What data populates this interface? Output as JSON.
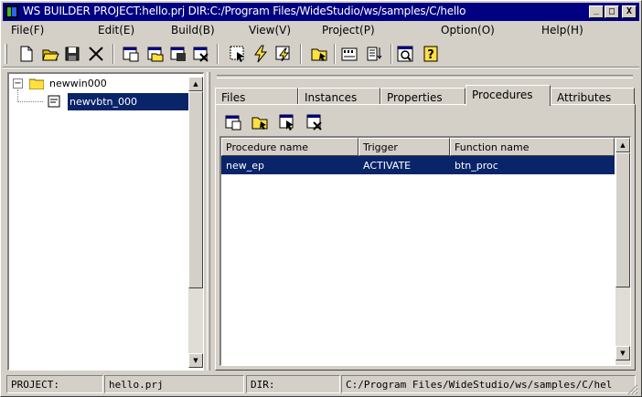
{
  "window": {
    "title": "WS BUILDER PROJECT:hello.prj DIR:C:/Program Files/WideStudio/ws/samples/C/hello",
    "minimize": "_",
    "maximize": "□",
    "close": "X"
  },
  "menu": [
    "File(F)",
    "Edit(E)",
    "Build(B)",
    "View(V)",
    "Project(P)",
    "Option(O)",
    "Help(H)"
  ],
  "toolbar": {
    "icons": [
      "new-file-icon",
      "open-folder-icon",
      "save-disk-icon",
      "cut-icon",
      "new-window-icon",
      "open-window-icon",
      "save-window-icon",
      "close-window-icon",
      "select-object-icon",
      "lightning-build-icon",
      "build-all-icon",
      "open-project-icon",
      "form-icon",
      "sort-list-icon",
      "preview-icon",
      "help-icon"
    ]
  },
  "tree": {
    "root": {
      "label": "newwin000",
      "expand": "⊟"
    },
    "child": {
      "label": "newvbtn_000"
    }
  },
  "tabs": [
    "Files",
    "Instances",
    "Properties",
    "Procedures",
    "Attributes"
  ],
  "active_tab": "Procedures",
  "proc_toolbar": [
    "new-procedure-icon",
    "open-procedure-icon",
    "edit-procedure-icon",
    "delete-procedure-icon"
  ],
  "table": {
    "headers": [
      "Procedure name",
      "Trigger",
      "Function name"
    ],
    "rows": [
      [
        "new_ep",
        "ACTIVATE",
        "btn_proc"
      ]
    ]
  },
  "status": {
    "project_label": "PROJECT:",
    "project_value": "hello.prj",
    "dir_label": "DIR:",
    "dir_value": "C:/Program Files/WideStudio/ws/samples/C/hel"
  },
  "colors": {
    "titlebar": "#000080",
    "selection": "#0a246a",
    "face": "#d4d0c8"
  }
}
